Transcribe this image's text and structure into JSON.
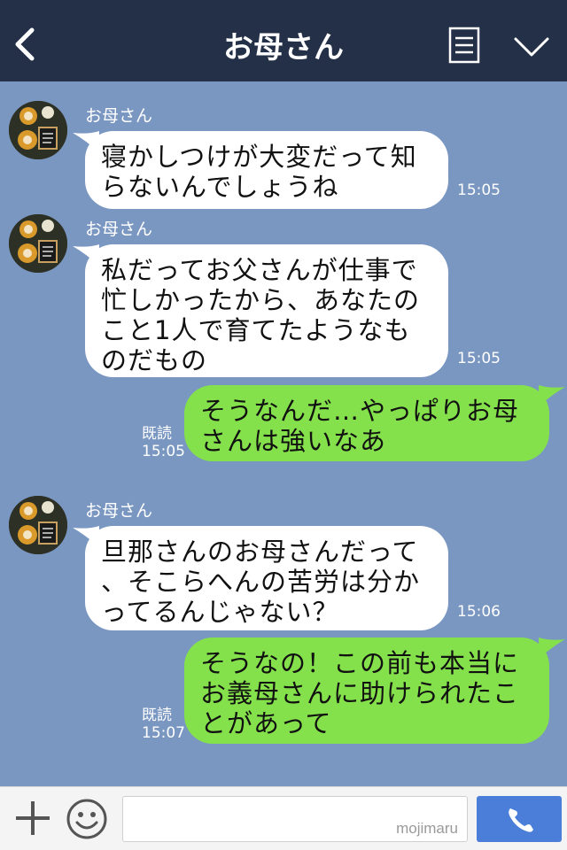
{
  "header": {
    "title": "お母さん",
    "icons": {
      "back": "chevron-left-icon",
      "menu": "note-list-icon",
      "more": "chevron-down-icon"
    }
  },
  "messages": [
    {
      "sender": "お母さん",
      "text": "寝かしつけが大変だって知\nらないんでしょうね",
      "time": "15:05"
    },
    {
      "sender": "お母さん",
      "text": "私だってお父さんが仕事で\n忙しかったから、あなたの\nこと1人で育てたようなも\nのだもの",
      "time": "15:05"
    },
    {
      "read": "既読",
      "text": "そうなんだ…やっぱりお母\nさんは強いなあ",
      "time": "15:05"
    },
    {
      "sender": "お母さん",
      "text": "旦那さんのお母さんだって\n、そこらへんの苦労は分か\nってるんじゃない？",
      "time": "15:06"
    },
    {
      "read": "既読",
      "text": "そうなの！この前も本当に\nお義母さんに助けられたこ\nとがあって",
      "time": "15:07"
    }
  ],
  "footer": {
    "watermark": "mojimaru",
    "icons": {
      "plus": "plus-icon",
      "emoji": "smiley-icon",
      "call": "phone-icon"
    }
  },
  "colors": {
    "header_bg": "#243047",
    "chat_bg": "#7a97c2",
    "incoming_bubble": "#ffffff",
    "outgoing_bubble": "#84e04b",
    "call_button": "#4a7ed9"
  }
}
